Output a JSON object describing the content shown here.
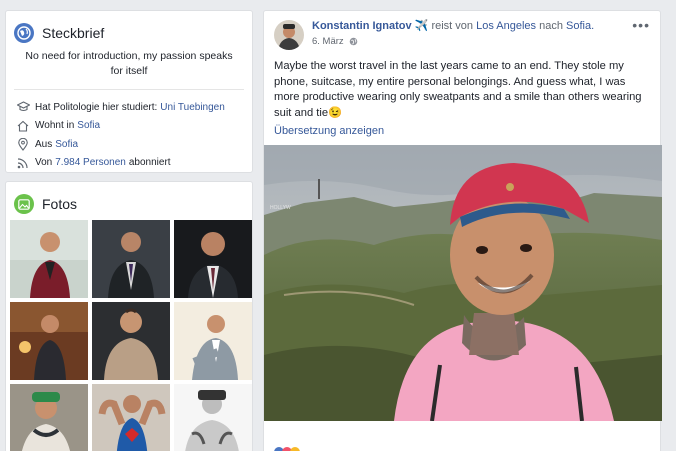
{
  "intro": {
    "title": "Steckbrief",
    "bio": "No need for introduction, my passion speaks for itself",
    "items": [
      {
        "icon": "graduation-cap-icon",
        "text": "Hat Politologie hier studiert:",
        "link": "Uni Tuebingen",
        "after": ""
      },
      {
        "icon": "home-icon",
        "text": "Wohnt in",
        "link": "Sofia",
        "after": ""
      },
      {
        "icon": "location-pin-icon",
        "text": "Aus",
        "link": "Sofia",
        "after": ""
      },
      {
        "icon": "rss-icon",
        "text": "Von",
        "link": "7.984 Personen",
        "after": "abonniert"
      }
    ]
  },
  "photos": {
    "title": "Fotos"
  },
  "post": {
    "author": "Konstantin Ignatov",
    "travel_emoji": "✈️",
    "travel_text": "reist von",
    "from": "Los Angeles",
    "nach": "nach",
    "to": "Sofia.",
    "date": "6. März",
    "body": "Maybe the worst travel in the last years came to an end. They stole my phone, suitcase, my entire personal belongings. And guess what, I was more productive wearing only sweatpants and a smile than others wearing suit and tie😉",
    "translate": "Übersetzung anzeigen"
  },
  "colors": {
    "link": "#365899",
    "background": "#e9ebee",
    "intro_icon": "#4a76c3",
    "photos_icon": "#6bc24b"
  }
}
